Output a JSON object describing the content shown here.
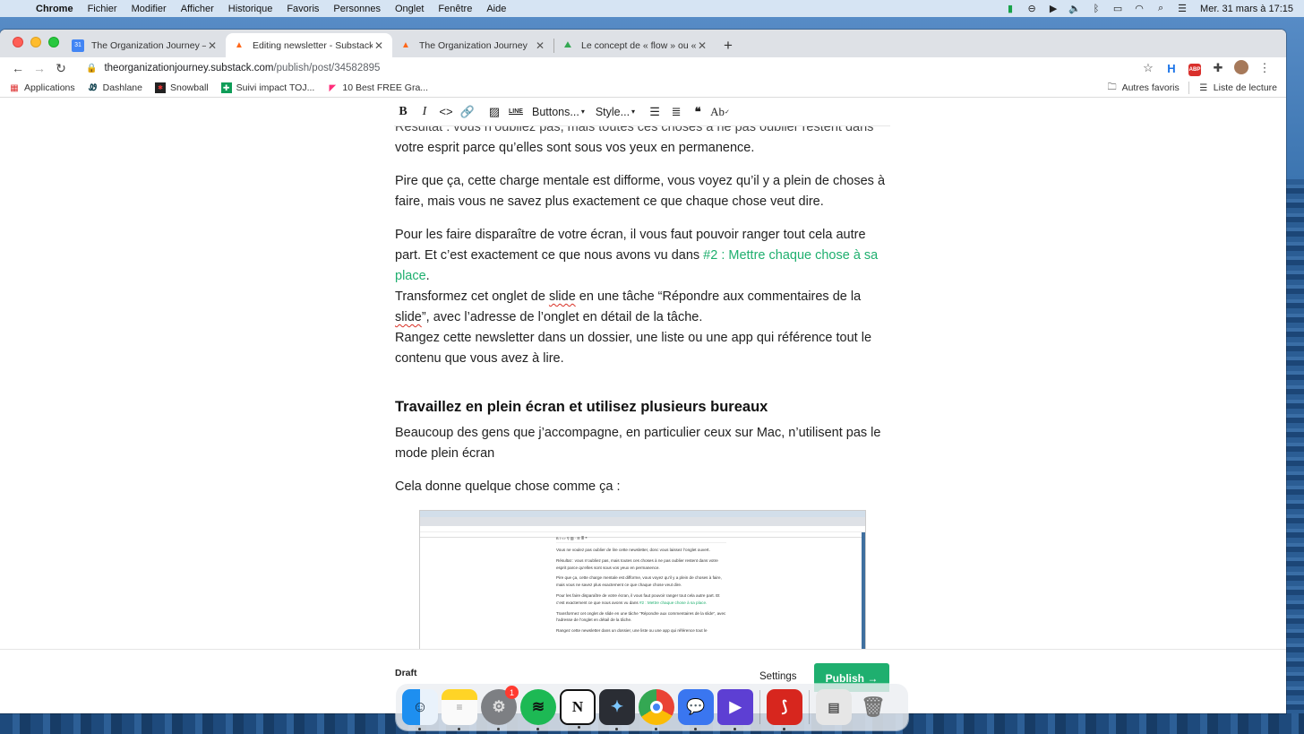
{
  "menubar": {
    "app": "Chrome",
    "items": [
      "Fichier",
      "Modifier",
      "Afficher",
      "Historique",
      "Favoris",
      "Personnes",
      "Onglet",
      "Fenêtre",
      "Aide"
    ],
    "clock": "Mer. 31 mars à  17:15"
  },
  "tabs": [
    {
      "title": "The Organization Journey – Ag",
      "favicon": "calendar-icon"
    },
    {
      "title": "Editing newsletter - Substack",
      "favicon": "substack-icon",
      "active": true
    },
    {
      "title": "The Organization Journey",
      "favicon": "substack-icon"
    },
    {
      "title": "Le concept de « flow » ou « ét",
      "favicon": "chart-icon"
    }
  ],
  "omnibox": {
    "host": "theorganizationjourney.substack.com",
    "path": "/publish/post/34582895"
  },
  "bookmarks": {
    "items": [
      {
        "label": "Applications",
        "icon": "grid-icon"
      },
      {
        "label": "Dashlane",
        "icon": "dashlane-icon"
      },
      {
        "label": "Snowball",
        "icon": "snowball-icon"
      },
      {
        "label": "Suivi impact TOJ...",
        "icon": "sheets-icon"
      },
      {
        "label": "10 Best FREE Gra...",
        "icon": "flag-icon"
      }
    ],
    "other": "Autres favoris",
    "reading_list": "Liste de lecture"
  },
  "editor_toolbar": {
    "buttons_label": "Buttons...",
    "style_label": "Style...",
    "line_label": "LINE",
    "ab_label": "Ab"
  },
  "article": {
    "cut_line": "Résultat : vous n’oubliez pas, mais toutes ces choses à ne pas oublier restent dans",
    "p1_rest": "votre esprit parce qu’elles sont sous vos yeux en permanence.",
    "p2": "Pire que ça, cette charge mentale est difforme, vous voyez qu’il y a plein de choses à faire, mais vous ne savez plus exactement ce que chaque chose veut dire.",
    "p3_before": "Pour les faire disparaître de votre écran, il vous faut pouvoir ranger tout cela autre part. Et c’est exactement ce que nous avons vu dans ",
    "p3_link": "#2 : Mettre chaque chose à sa place",
    "p3_after": ".",
    "p4_a": "Transformez cet onglet de ",
    "p4_slide1": "slide",
    "p4_b": " en une tâche “Répondre aux commentaires de la ",
    "p4_slide2": "slide",
    "p4_c": "”, avec l’adresse de l’onglet en détail de la tâche.",
    "p5": "Rangez cette newsletter dans un dossier, une liste ou une app qui référence tout le contenu que vous avez à lire.",
    "heading": "Travaillez en plein écran et utilisez plusieurs bureaux",
    "p6": "Beaucoup des gens que j’accompagne, en particulier ceux sur Mac, n’utilisent pas le mode plein écran",
    "p7": "Cela donne quelque chose comme ça :"
  },
  "embedded_screenshot": {
    "line1": "Vous ne voulez pas oublier de lire cette newsletter, donc vous laissez l’onglet ouvert.",
    "line2": "Résultat : vous n’oubliez pas, mais toutes ces choses à ne pas oublier restent dans votre esprit parce qu’elles sont sous vos yeux en permanence.",
    "line3": "Pire que ça, cette charge mentale est difforme, vous voyez qu’il y a plein de choses à faire, mais vous ne savez plus exactement ce que chaque chose veut dire.",
    "line4": "Pour les faire disparaître de votre écran, il vous faut pouvoir ranger tout cela autre part. Et c’est exactement ce que nous avons vu dans",
    "line4_link": "#2 : Mettre chaque chose à sa place.",
    "line5": "Transformez cet onglet de slide en une tâche “Répondre aux commentaires de la slide”, avec l’adresse de l’onglet en détail de la tâche.",
    "line6": "Rangez cette newsletter dans un dossier, une liste ou une app qui référence tout le"
  },
  "footer": {
    "draft": "Draft",
    "settings": "Settings",
    "publish": "Publish →"
  },
  "dock": {
    "settings_badge": "1"
  },
  "colors": {
    "accent_green": "#1faf6f",
    "tab_strip": "#dee1e6"
  }
}
